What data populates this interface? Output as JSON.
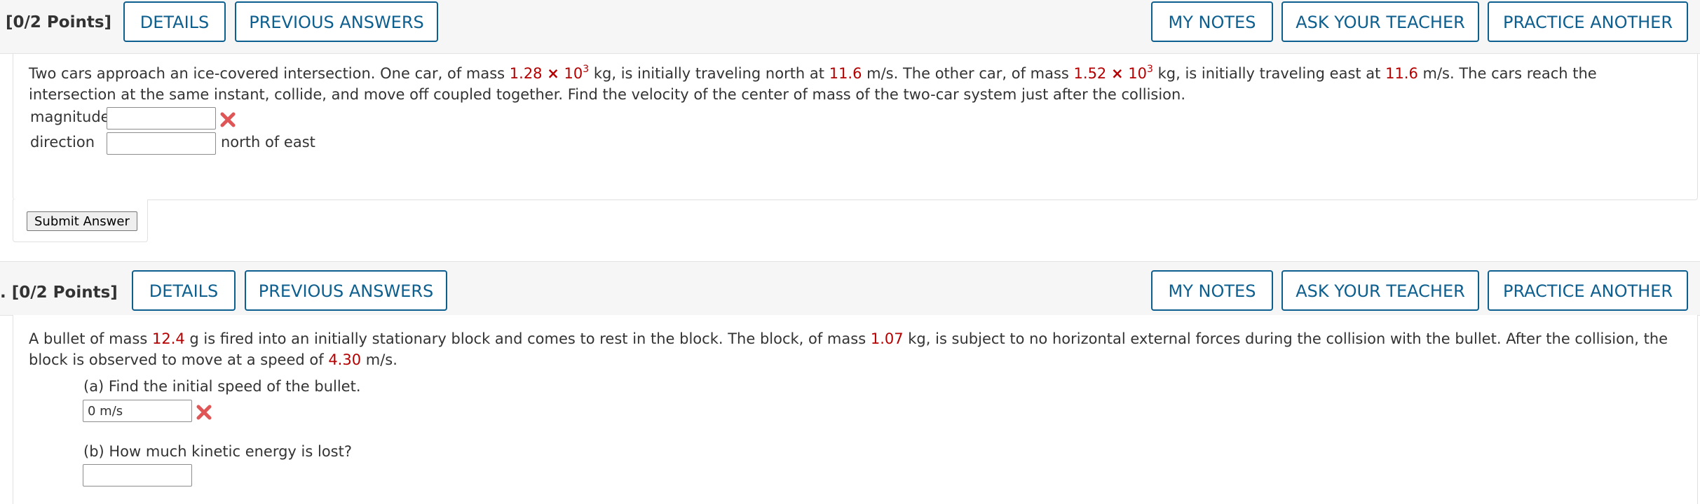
{
  "q1": {
    "points": "[0/2 Points]",
    "buttons": {
      "details": "DETAILS",
      "previous_answers": "PREVIOUS ANSWERS",
      "my_notes": "MY NOTES",
      "ask_teacher": "ASK YOUR TEACHER",
      "practice_another": "PRACTICE ANOTHER"
    },
    "stem": {
      "t1": "Two cars approach an ice-covered intersection. One car, of mass ",
      "m1_mant": "1.28",
      "times": "×",
      "base": "10",
      "exp": "3",
      "t2": " kg, is initially traveling north at ",
      "v1": "11.6",
      "t3": " m/s. The other car, of mass ",
      "m2_mant": "1.52",
      "t4": " kg, is initially traveling east at ",
      "v2": "11.6",
      "t5": " m/s. The cars reach the intersection at the same instant, collide, and move off coupled together. Find the velocity of the center of mass of the two-car system just after the collision."
    },
    "magnitude_label": "magnitude",
    "magnitude_value": "",
    "direction_label": "direction",
    "direction_value": "",
    "direction_unit": "north of east",
    "submit_label": "Submit Answer"
  },
  "q2": {
    "points": ". [0/2 Points]",
    "buttons": {
      "details": "DETAILS",
      "previous_answers": "PREVIOUS ANSWERS",
      "my_notes": "MY NOTES",
      "ask_teacher": "ASK YOUR TEACHER",
      "practice_another": "PRACTICE ANOTHER"
    },
    "stem": {
      "t1": "A bullet of mass ",
      "mb": "12.4",
      "t2": " g is fired into an initially stationary block and comes to rest in the block. The block, of mass ",
      "M": "1.07",
      "t3": " kg, is subject to no horizontal external forces during the collision with the bullet. After the collision, the block is observed to move at a speed of ",
      "v": "4.30",
      "t4": " m/s."
    },
    "part_a_label": "(a) Find the initial speed of the bullet.",
    "part_a_value": "0 m/s",
    "part_b_label": "(b) How much kinetic energy is lost?",
    "part_b_value": ""
  },
  "colors": {
    "button_blue": "#0c5f8f",
    "given_value_red": "#b40000",
    "incorrect_mark": "#e05555"
  },
  "icons": [
    "incorrect-x-icon"
  ]
}
